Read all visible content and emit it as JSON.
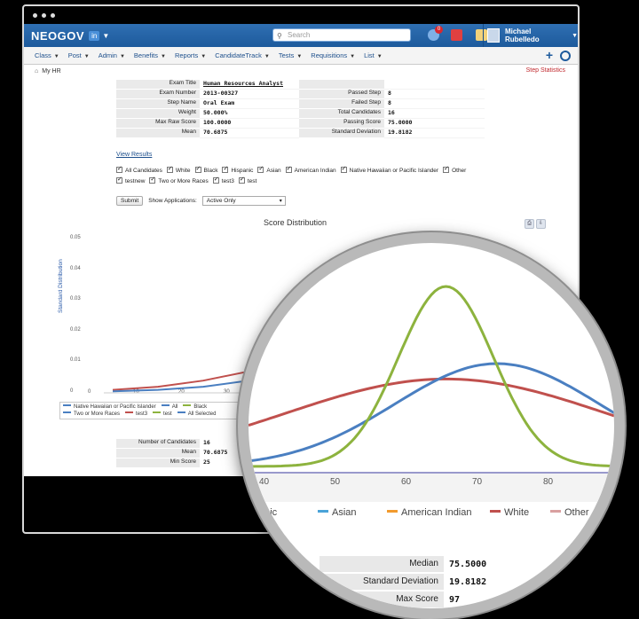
{
  "app": {
    "logo": "NEOGOV",
    "logo_badge": "in",
    "search_placeholder": "Search",
    "notification_count": "0",
    "user_name": "Michael Rubelledo"
  },
  "nav": {
    "items": [
      "Class",
      "Post",
      "Admin",
      "Benefits",
      "Reports",
      "CandidateTrack",
      "Tests",
      "Requisitions",
      "List"
    ],
    "plus": "+",
    "breadcrumb": "My HR",
    "step_statistics": "Step Statistics"
  },
  "info_table": {
    "rows": [
      {
        "l1": "Exam Title",
        "v1": "Human Resources Analyst",
        "l2": "",
        "v2": ""
      },
      {
        "l1": "Exam Number",
        "v1": "2013-00327",
        "l2": "Passed Step",
        "v2": "8"
      },
      {
        "l1": "Step Name",
        "v1": "Oral Exam",
        "l2": "Failed Step",
        "v2": "8"
      },
      {
        "l1": "Weight",
        "v1": "50.000%",
        "l2": "Total Candidates",
        "v2": "16"
      },
      {
        "l1": "Max Raw Score",
        "v1": "100.0000",
        "l2": "Passing Score",
        "v2": "75.0000"
      },
      {
        "l1": "Mean",
        "v1": "70.6875",
        "l2": "Standard Deviation",
        "v2": "19.8182"
      }
    ]
  },
  "view_results": "View Results",
  "checkboxes": [
    "All Candidates",
    "White",
    "Black",
    "Hispanic",
    "Asian",
    "American Indian",
    "Native Hawaiian or Pacific Islander",
    "Other",
    "testnew",
    "Two or More Races",
    "test3",
    "test"
  ],
  "controls": {
    "submit": "Submit",
    "show_label": "Show Applications:",
    "show_value": "Active Only"
  },
  "chart_data": {
    "type": "line",
    "title": "Score Distribution",
    "ylabel": "Standard Distribution",
    "xlabel": "",
    "y_ticks": [
      "0.05",
      "0.04",
      "0.03",
      "0.02",
      "0.01",
      "0"
    ],
    "x_ticks": [
      "0",
      "10",
      "20",
      "30"
    ],
    "ylim": [
      0,
      0.05
    ],
    "legend": [
      "Native Hawaiian or Pacific Islander",
      "All",
      "Black",
      "Two or More Races",
      "test3",
      "test",
      "All Selected"
    ],
    "series": [
      {
        "name": "White",
        "color": "#c0504d",
        "x": [
          0,
          10,
          20,
          30,
          40,
          50,
          60,
          70,
          80,
          90
        ],
        "values": [
          0.001,
          0.002,
          0.004,
          0.007,
          0.011,
          0.015,
          0.017,
          0.016,
          0.012,
          0.008
        ]
      },
      {
        "name": "Asian",
        "color": "#4a7fc1",
        "x": [
          0,
          10,
          20,
          30,
          40,
          50,
          60,
          70,
          80,
          90
        ],
        "values": [
          0.0005,
          0.001,
          0.002,
          0.004,
          0.008,
          0.014,
          0.019,
          0.02,
          0.017,
          0.011
        ]
      },
      {
        "name": "Black",
        "color": "#8db33e",
        "x": [
          40,
          45,
          50,
          55,
          60,
          63,
          66,
          70,
          75,
          80
        ],
        "values": [
          0.0,
          0.002,
          0.008,
          0.022,
          0.033,
          0.035,
          0.032,
          0.022,
          0.008,
          0.0
        ]
      }
    ]
  },
  "mag": {
    "x_ticks": [
      "40",
      "50",
      "60",
      "70",
      "80"
    ],
    "legend": [
      {
        "label": "Hispanic",
        "color": "#7f6fae"
      },
      {
        "label": "Asian",
        "color": "#4aa3d8"
      },
      {
        "label": "American Indian",
        "color": "#f29a2e"
      },
      {
        "label": "White",
        "color": "#c0504d"
      },
      {
        "label": "Other",
        "color": "#d9a0a0"
      }
    ],
    "stats": [
      {
        "l": "Median",
        "v": "75.5000"
      },
      {
        "l": "Standard Deviation",
        "v": "19.8182"
      },
      {
        "l": "Max Score",
        "v": "97"
      }
    ]
  },
  "stats2": [
    {
      "l": "Number of Candidates",
      "v": "16"
    },
    {
      "l": "Mean",
      "v": "70.6875"
    },
    {
      "l": "Min Score",
      "v": "25"
    }
  ]
}
